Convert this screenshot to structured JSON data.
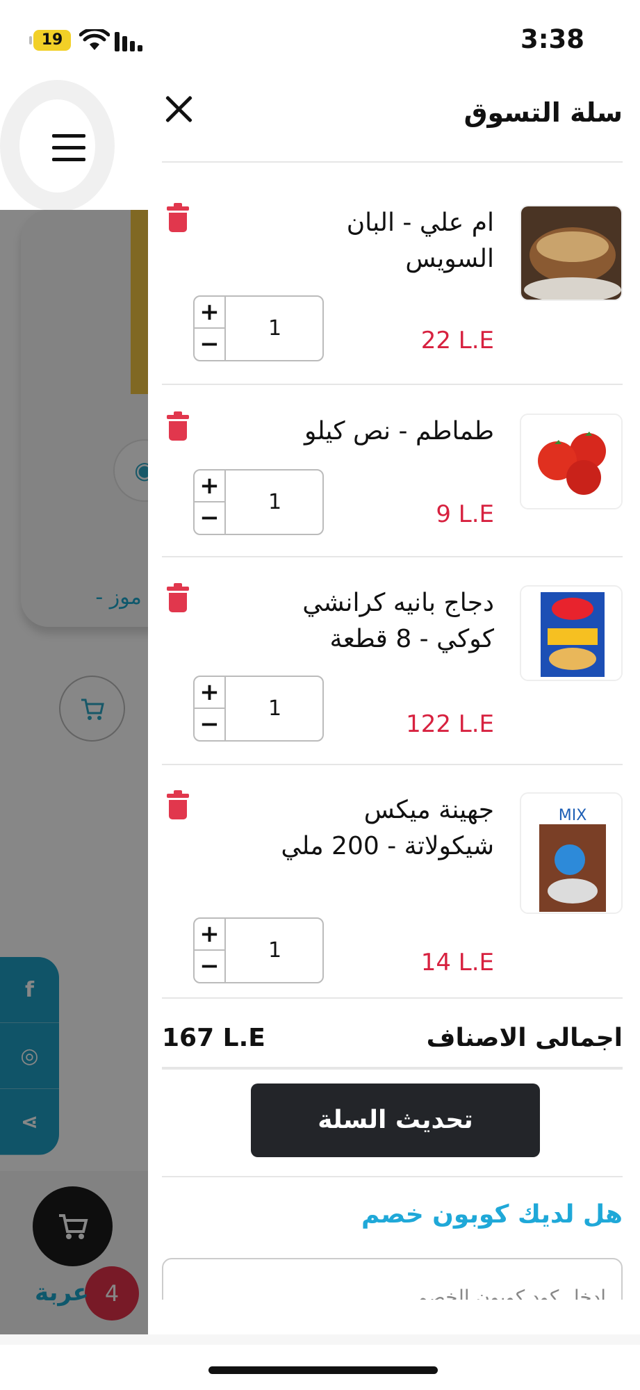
{
  "status": {
    "time": "3:38",
    "battery": "19"
  },
  "background": {
    "product_title": "س موز - لي",
    "bottom_label": "عربة",
    "cart_count": "4"
  },
  "drawer": {
    "title": "سلة التسوق",
    "items": [
      {
        "name": "ام علي - البان السويس",
        "price": "22 L.E",
        "qty": "1"
      },
      {
        "name": "طماطم - نص كيلو",
        "price": "9 L.E",
        "qty": "1"
      },
      {
        "name": "دجاج بانيه كرانشي كوكي - 8 قطعة",
        "price": "122 L.E",
        "qty": "1"
      },
      {
        "name": "جهينة ميكس شيكولاتة - 200 ملي",
        "price": "14 L.E",
        "qty": "1"
      }
    ],
    "qty_plus": "+",
    "qty_minus": "−",
    "total_label": "اجمالى الاصناف",
    "total_value": "167 L.E",
    "update_button": "تحديث السلة",
    "coupon_question": "هل لديك كوبون خصم",
    "coupon_placeholder": "ادخل كود كوبون الخصم"
  },
  "colors": {
    "accent": "#1fa8d8",
    "price": "#d7213f",
    "button": "#232529"
  }
}
